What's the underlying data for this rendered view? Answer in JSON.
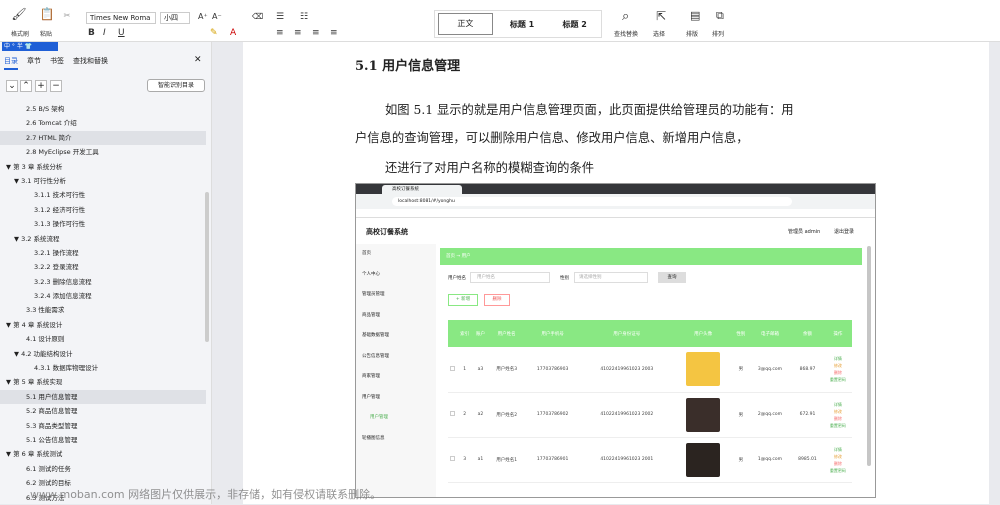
{
  "toolbar": {
    "format_painter": "格式刷",
    "paste": "粘贴",
    "font": "Times New Roma",
    "size": "小四",
    "styles": [
      "正文",
      "标题 1",
      "标题 2"
    ],
    "find_replace": "查找替换",
    "select": "选择",
    "layout": "排版",
    "arrange": "排列"
  },
  "sidebar": {
    "tabs": [
      "目录",
      "章节",
      "书签",
      "查找和替换"
    ],
    "smart": "智能识别目录",
    "toc": [
      {
        "text": "2.5 B/S 架构",
        "level": 2
      },
      {
        "text": "2.6 Tomcat 介绍",
        "level": 2
      },
      {
        "text": "2.7 HTML 简介",
        "level": 2,
        "hl": true
      },
      {
        "text": "2.8 MyEclipse 开发工具",
        "level": 2
      },
      {
        "text": "▼ 第 3 章 系统分析",
        "level": 0
      },
      {
        "text": "▼ 3.1 可行性分析",
        "level": 1
      },
      {
        "text": "3.1.1 技术可行性",
        "level": 3
      },
      {
        "text": "3.1.2 经济可行性",
        "level": 3
      },
      {
        "text": "3.1.3 操作可行性",
        "level": 3
      },
      {
        "text": "▼ 3.2 系统流程",
        "level": 1
      },
      {
        "text": "3.2.1 操作流程",
        "level": 3
      },
      {
        "text": "3.2.2 登录流程",
        "level": 3
      },
      {
        "text": "3.2.3 删除信息流程",
        "level": 3
      },
      {
        "text": "3.2.4 添加信息流程",
        "level": 3
      },
      {
        "text": "3.3 性能需求",
        "level": 2
      },
      {
        "text": "▼ 第 4 章 系统设计",
        "level": 0
      },
      {
        "text": "4.1 设计原则",
        "level": 2
      },
      {
        "text": "▼ 4.2 功能结构设计",
        "level": 1
      },
      {
        "text": "4.3.1 数据库物理设计",
        "level": 3
      },
      {
        "text": "▼ 第 5 章 系统实现",
        "level": 0
      },
      {
        "text": "5.1 用户信息管理",
        "level": 2,
        "hl": true
      },
      {
        "text": "5.2 商品信息管理",
        "level": 2
      },
      {
        "text": "5.3 商品类型管理",
        "level": 2
      },
      {
        "text": "5.1 公告信息管理",
        "level": 2
      },
      {
        "text": "▼ 第 6 章 系统测试",
        "level": 0
      },
      {
        "text": "6.1 测试的任务",
        "level": 2
      },
      {
        "text": "6.2 测试的目标",
        "level": 2
      },
      {
        "text": "6.3 测试方法",
        "level": 2
      }
    ]
  },
  "doc": {
    "heading": "5.1 用户信息管理",
    "line1": "如图 5.1 显示的就是用户信息管理页面，此页面提供给管理员的功能有：用",
    "line2": "户信息的查询管理，可以删除用户信息、修改用户信息、新增用户信息，",
    "line3": "还进行了对用户名称的模糊查询的条件"
  },
  "shot": {
    "tab": "高校订餐系统",
    "url": "localhost:8081/#/yonghu",
    "app_title": "高校订餐系统",
    "admin": "管理员 admin",
    "logout": "退出登录",
    "menu": [
      "首页",
      "个人中心",
      "管理员管理",
      "商品管理",
      "基础数据管理",
      "公告信息管理",
      "商家管理",
      "用户管理",
      "用户管理",
      "轮播图信息"
    ],
    "crumb": "首页 → 用户",
    "search_label": "用户姓名",
    "search_ph": "用户姓名",
    "gender_label": "性别",
    "gender_ph": "请选择性别",
    "query": "查询",
    "add": "+ 新增",
    "del": "删除",
    "headers": [
      "",
      "索引",
      "账户",
      "用户姓名",
      "用户手机号",
      "用户身份证号",
      "用户头像",
      "性别",
      "电子邮箱",
      "余额",
      "操作"
    ],
    "rows": [
      {
        "idx": "1",
        "acct": "a3",
        "name": "用户姓名3",
        "phone": "17703786903",
        "id": "41022419961023 2003",
        "gender": "男",
        "email": "3@qq.com",
        "bal": "868.97"
      },
      {
        "idx": "2",
        "acct": "a2",
        "name": "用户姓名2",
        "phone": "17703786902",
        "id": "41022419961023 2002",
        "gender": "男",
        "email": "2@qq.com",
        "bal": "672.91"
      },
      {
        "idx": "3",
        "acct": "a1",
        "name": "用户姓名1",
        "phone": "17703786901",
        "id": "41022419961023 2001",
        "gender": "男",
        "email": "1@qq.com",
        "bal": "8985.01"
      }
    ],
    "ops": [
      "详情",
      "修改",
      "删除",
      "重置密码"
    ]
  },
  "watermark": "www.moban.com 网络图片仅供展示，非存储，如有侵权请联系删除。"
}
